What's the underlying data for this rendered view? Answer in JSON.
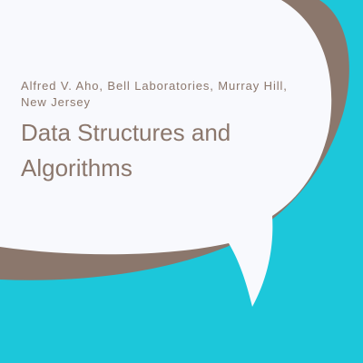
{
  "cover": {
    "author": "Alfred V. Aho, Bell Laboratories, Murray Hill, New Jersey",
    "title": "Data Structures and Algorithms"
  },
  "colors": {
    "background": "#1CC7DA",
    "shadow_bubble": "#8B776C",
    "main_bubble": "#F8F9FD",
    "text": "#8B776C"
  }
}
